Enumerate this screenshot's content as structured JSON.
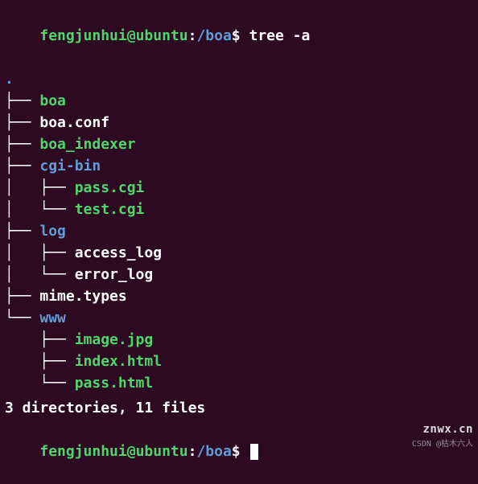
{
  "prompt1": {
    "user_host": "fengjunhui@ubuntu",
    "colon": ":",
    "path": "/boa",
    "symbol": "$",
    "command": "tree -a"
  },
  "tree": {
    "root": ".",
    "lines": [
      {
        "conn": "├── ",
        "name": "boa",
        "cls": "file-exec"
      },
      {
        "conn": "├── ",
        "name": "boa.conf",
        "cls": "file-regular"
      },
      {
        "conn": "├── ",
        "name": "boa_indexer",
        "cls": "file-exec"
      },
      {
        "conn": "├── ",
        "name": "cgi-bin",
        "cls": "dir"
      },
      {
        "conn": "│   ├── ",
        "name": "pass.cgi",
        "cls": "file-exec"
      },
      {
        "conn": "│   └── ",
        "name": "test.cgi",
        "cls": "file-exec"
      },
      {
        "conn": "├── ",
        "name": "log",
        "cls": "dir"
      },
      {
        "conn": "│   ├── ",
        "name": "access_log",
        "cls": "file-regular"
      },
      {
        "conn": "│   └── ",
        "name": "error_log",
        "cls": "file-regular"
      },
      {
        "conn": "├── ",
        "name": "mime.types",
        "cls": "file-regular"
      },
      {
        "conn": "└── ",
        "name": "www",
        "cls": "dir"
      },
      {
        "conn": "    ├── ",
        "name": "image.jpg",
        "cls": "file-exec"
      },
      {
        "conn": "    ├── ",
        "name": "index.html",
        "cls": "file-exec"
      },
      {
        "conn": "    └── ",
        "name": "pass.html",
        "cls": "file-exec"
      }
    ]
  },
  "summary": "3 directories, 11 files",
  "prompt2": {
    "user_host": "fengjunhui@ubuntu",
    "colon": ":",
    "path": "/boa",
    "symbol": "$"
  },
  "watermark": {
    "top": "znwx.cn",
    "bottom": "CSDN @枯木六人"
  }
}
